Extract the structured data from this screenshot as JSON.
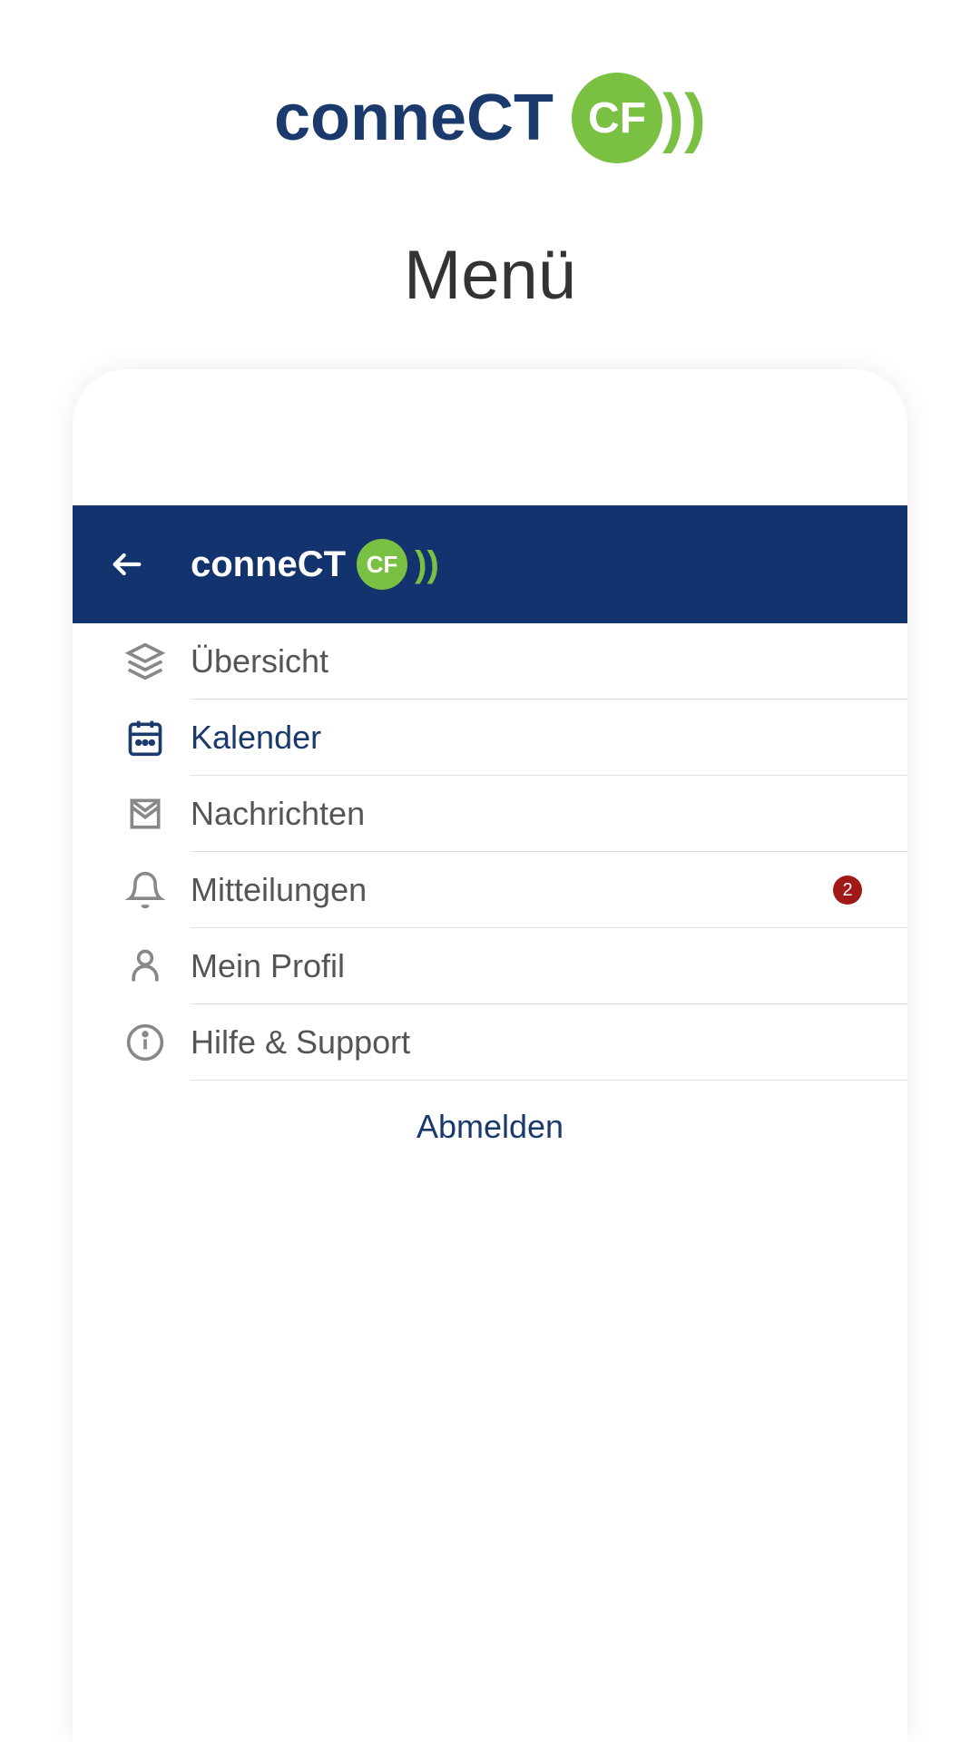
{
  "outerLogo": {
    "text": "conneCT",
    "badge": "CF"
  },
  "pageTitle": "Menü",
  "appHeader": {
    "logoText": "conneCT",
    "logoBadge": "CF"
  },
  "menu": {
    "items": [
      {
        "label": "Übersicht",
        "icon": "layers",
        "active": false
      },
      {
        "label": "Kalender",
        "icon": "calendar",
        "active": true
      },
      {
        "label": "Nachrichten",
        "icon": "mail",
        "active": false
      },
      {
        "label": "Mitteilungen",
        "icon": "bell",
        "active": false,
        "badge": "2"
      },
      {
        "label": "Mein Profil",
        "icon": "user",
        "active": false
      },
      {
        "label": "Hilfe & Support",
        "icon": "info",
        "active": false
      }
    ]
  },
  "logout": "Abmelden"
}
